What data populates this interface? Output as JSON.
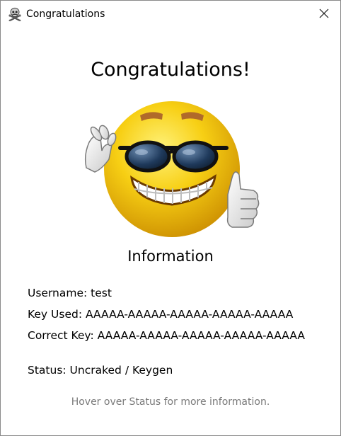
{
  "window": {
    "title": "Congratulations",
    "icon": "skull-crossbones-icon",
    "close_icon": "close-icon"
  },
  "main": {
    "heading": "Congratulations!",
    "image": "sunglasses-thumbs-up-emoji",
    "info_heading": "Information",
    "username": "Username: test",
    "key_used": "Key Used: AAAAA-AAAAA-AAAAA-AAAAA-AAAAA",
    "correct_key": "Correct Key: AAAAA-AAAAA-AAAAA-AAAAA-AAAAA",
    "status": "Status: Uncraked / Keygen",
    "hint": "Hover over Status for more information."
  },
  "colors": {
    "hint": "#7a7a7a",
    "emoji_face": "#f5c400",
    "background": "#ffffff"
  }
}
